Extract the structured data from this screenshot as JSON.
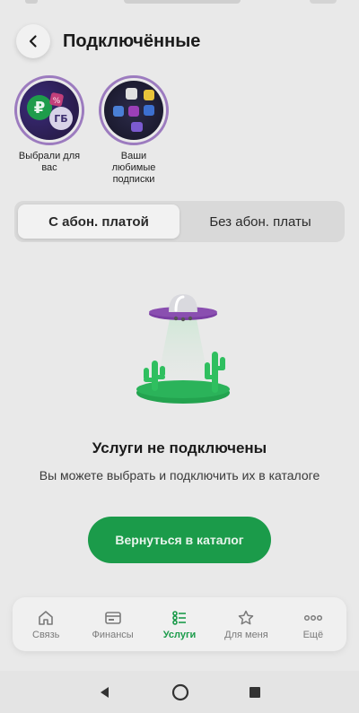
{
  "header": {
    "title": "Подключённые",
    "back_icon": "chevron-left-icon"
  },
  "stories": [
    {
      "label": "Выбрали для вас",
      "image": "story-picked-image"
    },
    {
      "label": "Ваши любимые подписки",
      "image": "story-subscriptions-image"
    }
  ],
  "tabs": [
    {
      "label": "С абон. платой",
      "active": true
    },
    {
      "label": "Без абон. платы",
      "active": false
    }
  ],
  "empty": {
    "title": "Услуги не подключены",
    "subtitle": "Вы можете выбрать и подключить их в каталоге",
    "illustration": "ufo-cactus-illustration"
  },
  "catalog_button": {
    "label": "Вернуться в каталог"
  },
  "bottom_nav": [
    {
      "label": "Связь",
      "icon": "home-icon",
      "active": false
    },
    {
      "label": "Финансы",
      "icon": "wallet-icon",
      "active": false
    },
    {
      "label": "Услуги",
      "icon": "list-icon",
      "active": true
    },
    {
      "label": "Для меня",
      "icon": "star-icon",
      "active": false
    },
    {
      "label": "Ещё",
      "icon": "more-icon",
      "active": false
    }
  ],
  "colors": {
    "accent": "#1b9b4a",
    "ring": "#9c7bbf",
    "ufo": "#8a4fb0"
  }
}
